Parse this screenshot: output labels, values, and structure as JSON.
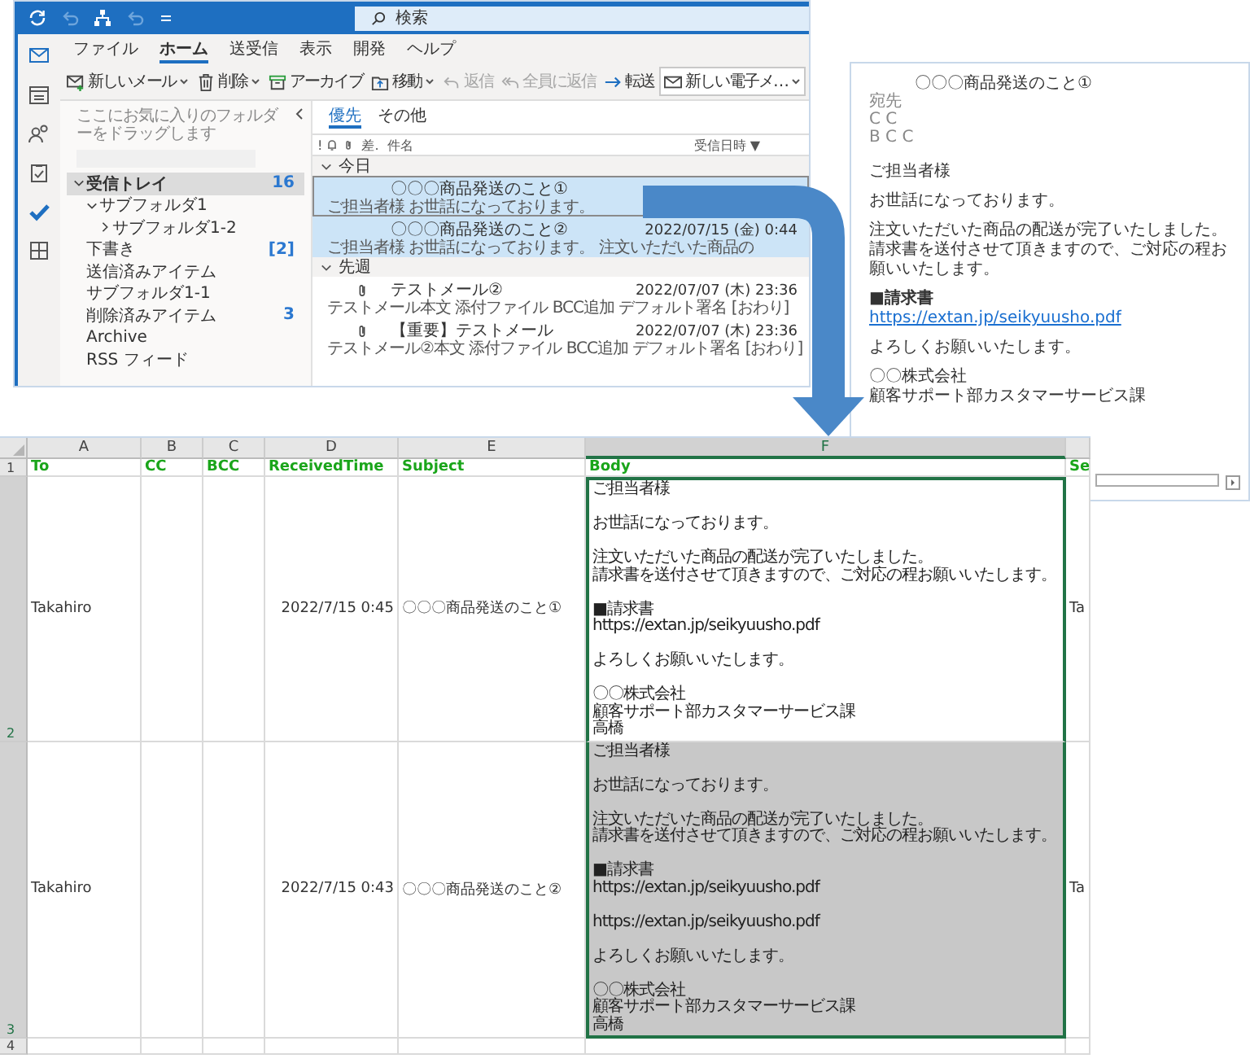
{
  "outlook": {
    "search_placeholder": "検索",
    "ribbon_tabs": [
      {
        "label": "ファイル",
        "selected": false
      },
      {
        "label": "ホーム",
        "selected": true
      },
      {
        "label": "送受信",
        "selected": false
      },
      {
        "label": "表示",
        "selected": false
      },
      {
        "label": "開発",
        "selected": false
      },
      {
        "label": "ヘルプ",
        "selected": false
      }
    ],
    "toolbar": [
      {
        "kind": "compose",
        "label": "新しいメール",
        "dropdown": true,
        "disabled": false
      },
      {
        "kind": "delete",
        "label": "削除",
        "dropdown": true,
        "disabled": false
      },
      {
        "kind": "archive",
        "label": "アーカイブ",
        "dropdown": false,
        "disabled": false
      },
      {
        "kind": "move",
        "label": "移動",
        "dropdown": true,
        "disabled": false
      },
      {
        "kind": "reply",
        "label": "返信",
        "dropdown": false,
        "disabled": true
      },
      {
        "kind": "replyall",
        "label": "全員に返信",
        "dropdown": false,
        "disabled": true
      },
      {
        "kind": "forward",
        "label": "転送",
        "dropdown": false,
        "disabled": false
      },
      {
        "kind": "quickstep",
        "label": "新しい電子メ…",
        "dropdown": true,
        "disabled": false
      }
    ],
    "favorites_hint": "ここにお気に入りのフォルダーをドラッグします",
    "folders": [
      {
        "name": "受信トレイ",
        "count": "16",
        "selected": true,
        "expanded": true,
        "children": [
          {
            "name": "サブフォルダ1",
            "selected": false,
            "expanded": true,
            "children": [
              {
                "name": "サブフォルダ1-2",
                "selected": false,
                "expanded": false
              }
            ]
          }
        ]
      },
      {
        "name": "下書き",
        "count": "[2]",
        "selected": false
      },
      {
        "name": "送信済みアイテム",
        "selected": false
      },
      {
        "name": "サブフォルダ1-1",
        "selected": false
      },
      {
        "name": "削除済みアイテム",
        "count": "3",
        "selected": false
      },
      {
        "name": "Archive",
        "selected": false
      },
      {
        "name": "RSS フィード",
        "selected": false
      }
    ],
    "list_tabs": [
      {
        "label": "優先",
        "selected": true
      },
      {
        "label": "その他",
        "selected": false
      }
    ],
    "list_header": {
      "importance": "!",
      "from": "差.",
      "subject": "件名",
      "received": "受信日時",
      "sort_mark": "▼"
    },
    "groups": [
      {
        "label": "今日",
        "expanded": true,
        "messages": [
          {
            "subject": "〇〇〇商品発送のこと①",
            "preview": "ご担当者様 お世話になっております。",
            "attachment": false,
            "selected": true,
            "focused": true
          },
          {
            "subject": "〇〇〇商品発送のこと②",
            "date": "2022/07/15 (金) 0:44",
            "preview": "ご担当者様 お世話になっております。 注文いただいた商品の",
            "attachment": false,
            "selected": true,
            "focused": false
          }
        ]
      },
      {
        "label": "先週",
        "expanded": true,
        "messages": [
          {
            "subject": "テストメール②",
            "date": "2022/07/07 (木) 23:36",
            "preview": "テストメール本文 添付ファイル BCC追加 デフォルト署名 [おわり]",
            "attachment": true,
            "selected": false,
            "focused": false
          },
          {
            "subject": "【重要】テストメール",
            "date": "2022/07/07 (木) 23:36",
            "preview": "テストメール②本文 添付ファイル BCC追加 デフォルト署名 [おわり]",
            "attachment": true,
            "selected": false,
            "focused": false
          }
        ]
      }
    ]
  },
  "reading_pane": {
    "subject": "〇〇〇商品発送のこと①",
    "to_label": "宛先",
    "cc_label": "C C",
    "bcc_label": "B C C",
    "body_blocks": [
      [
        {
          "kind": "text",
          "text": "ご担当者様"
        }
      ],
      [
        {
          "kind": "text",
          "text": "お世話になっております。"
        }
      ],
      [
        {
          "kind": "text",
          "text": "注文いただいた商品の配送が完了いたしました。"
        },
        {
          "kind": "text",
          "text": "請求書を送付させて頂きますので、ご対応の程お願いいたします。"
        }
      ],
      [
        {
          "kind": "heading",
          "text": "■請求書"
        },
        {
          "kind": "link",
          "text": "https://extan.jp/seikyuusho.pdf"
        }
      ],
      [
        {
          "kind": "text",
          "text": "よろしくお願いいたします。"
        }
      ],
      [
        {
          "kind": "text",
          "text": "〇〇株式会社"
        },
        {
          "kind": "text",
          "text": "顧客サポート部カスタマーサービス課"
        }
      ]
    ]
  },
  "excel": {
    "columns": [
      {
        "label": "A",
        "selected": false
      },
      {
        "label": "B",
        "selected": false
      },
      {
        "label": "C",
        "selected": false
      },
      {
        "label": "D",
        "selected": false
      },
      {
        "label": "E",
        "selected": false
      },
      {
        "label": "F",
        "selected": true
      }
    ],
    "header_row": {
      "number": "1",
      "cells": [
        "To",
        "CC",
        "BCC",
        "ReceivedTime",
        "Subject",
        "Body",
        "Se"
      ]
    },
    "rows": [
      {
        "number": "2",
        "selected": true,
        "shaded": false,
        "cells": {
          "to": "Takahiro",
          "received_time": "2022/7/15 0:45",
          "subject": "〇〇〇商品発送のこと①",
          "body": [
            [
              "ご担当者様"
            ],
            [
              "お世話になっております。"
            ],
            [
              "注文いただいた商品の配送が完了いたしました。",
              "請求書を送付させて頂きますので、ご対応の程お願いいたします。"
            ],
            [
              "■請求書",
              "https://extan.jp/seikyuusho.pdf"
            ],
            [
              "よろしくお願いいたします。"
            ],
            [
              "〇〇株式会社",
              "顧客サポート部カスタマーサービス課",
              "高橋"
            ]
          ],
          "column_7": "Ta"
        }
      },
      {
        "number": "3",
        "selected": true,
        "shaded": true,
        "cells": {
          "to": "Takahiro",
          "received_time": "2022/7/15 0:43",
          "subject": "〇〇〇商品発送のこと②",
          "body": [
            [
              "ご担当者様"
            ],
            [
              "お世話になっております。"
            ],
            [
              "注文いただいた商品の配送が完了いたしました。",
              "請求書を送付させて頂きますので、ご対応の程お願いいたします。"
            ],
            [
              "■請求書",
              "https://extan.jp/seikyuusho.pdf"
            ],
            [
              "https://extan.jp/seikyuusho.pdf"
            ],
            [
              "よろしくお願いいたします。"
            ],
            [
              "〇〇株式会社",
              "顧客サポート部カスタマーサービス課",
              "高橋"
            ]
          ],
          "column_7": "Ta"
        }
      },
      {
        "number": "4",
        "selected": false,
        "shaded": false
      }
    ]
  }
}
